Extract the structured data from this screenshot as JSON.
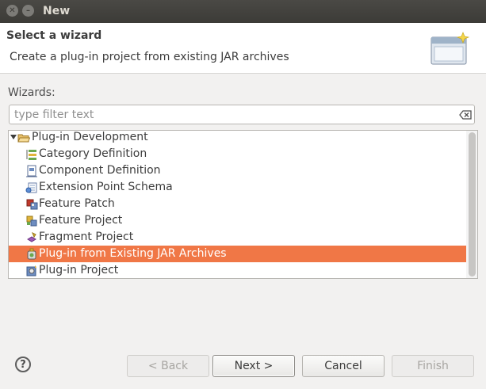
{
  "window": {
    "title": "New"
  },
  "header": {
    "title": "Select a wizard",
    "description": "Create a plug-in project from existing JAR archives"
  },
  "wizards_label": "Wizards:",
  "filter": {
    "placeholder": "type filter text",
    "value": ""
  },
  "tree": {
    "items": [
      {
        "label": "Plug-in Development",
        "icon": "folder-open-icon",
        "expanded": true,
        "selected": false
      },
      {
        "label": "Category Definition",
        "icon": "category-definition-icon",
        "selected": false
      },
      {
        "label": "Component Definition",
        "icon": "component-definition-icon",
        "selected": false
      },
      {
        "label": "Extension Point Schema",
        "icon": "extension-point-schema-icon",
        "selected": false
      },
      {
        "label": "Feature Patch",
        "icon": "feature-patch-icon",
        "selected": false
      },
      {
        "label": "Feature Project",
        "icon": "feature-project-icon",
        "selected": false
      },
      {
        "label": "Fragment Project",
        "icon": "fragment-project-icon",
        "selected": false
      },
      {
        "label": "Plug-in from Existing JAR Archives",
        "icon": "plugin-from-jar-icon",
        "selected": true
      },
      {
        "label": "Plug-in Project",
        "icon": "plugin-project-icon",
        "selected": false
      }
    ]
  },
  "buttons": {
    "help": "?",
    "back": "< Back",
    "next": "Next >",
    "cancel": "Cancel",
    "finish": "Finish"
  },
  "colors": {
    "selection": "#f07746",
    "titlebar": "#3c3b37"
  }
}
